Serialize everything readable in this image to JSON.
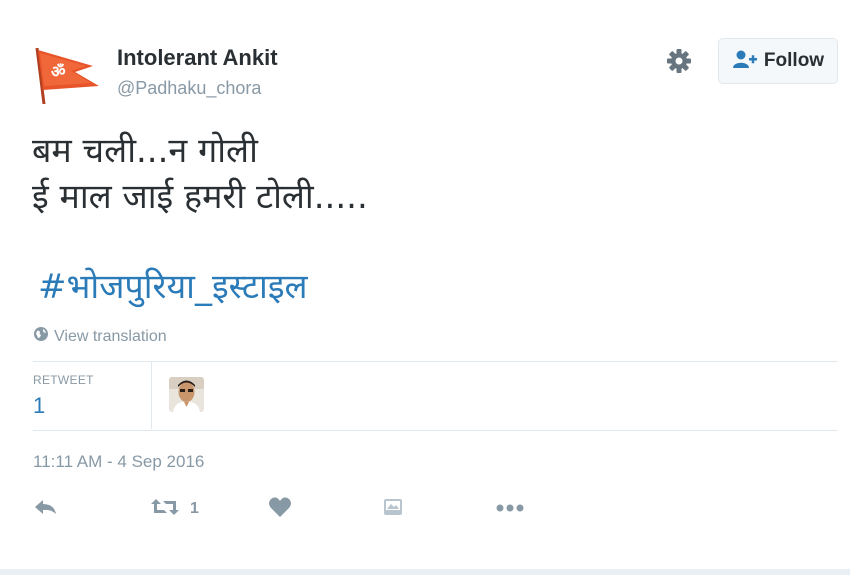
{
  "author": {
    "name": "Intolerant Ankit",
    "handle": "@Padhaku_chora"
  },
  "follow_button": {
    "label": "Follow"
  },
  "tweet": {
    "line1": "बम चली...न गोली",
    "line2": "ई माल जाई हमरी टोली.....",
    "hashtag": "#भोजपुरिया_इस्टाइल",
    "translate_label": "View translation"
  },
  "stats": {
    "retweet_label": "RETWEET",
    "retweet_count": "1"
  },
  "timestamp": "11:11 AM - 4 Sep 2016",
  "actions": {
    "retweet_count": "1"
  },
  "colors": {
    "link": "#2b7bb9",
    "muted": "#8899a6",
    "flag": "#e8542a"
  }
}
